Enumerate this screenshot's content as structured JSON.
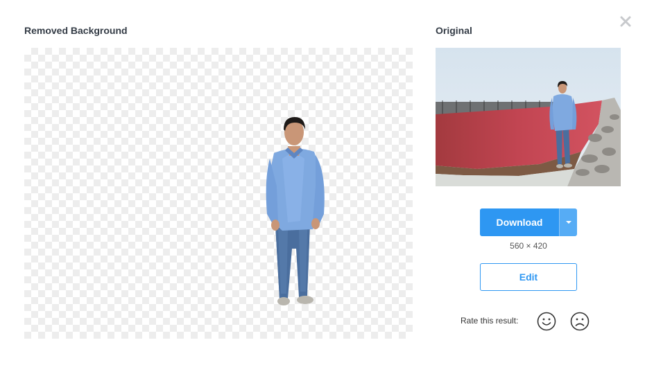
{
  "headings": {
    "removed": "Removed Background",
    "original": "Original"
  },
  "actions": {
    "download_label": "Download",
    "dimensions": "560 × 420",
    "edit_label": "Edit"
  },
  "rating": {
    "label": "Rate this result:"
  },
  "icons": {
    "close": "close-icon",
    "caret": "chevron-down-icon",
    "happy": "smiley-happy-icon",
    "sad": "smiley-sad-icon"
  },
  "colors": {
    "primary": "#2e97f2",
    "primary_light": "#56acf5",
    "heading": "#333b45"
  }
}
